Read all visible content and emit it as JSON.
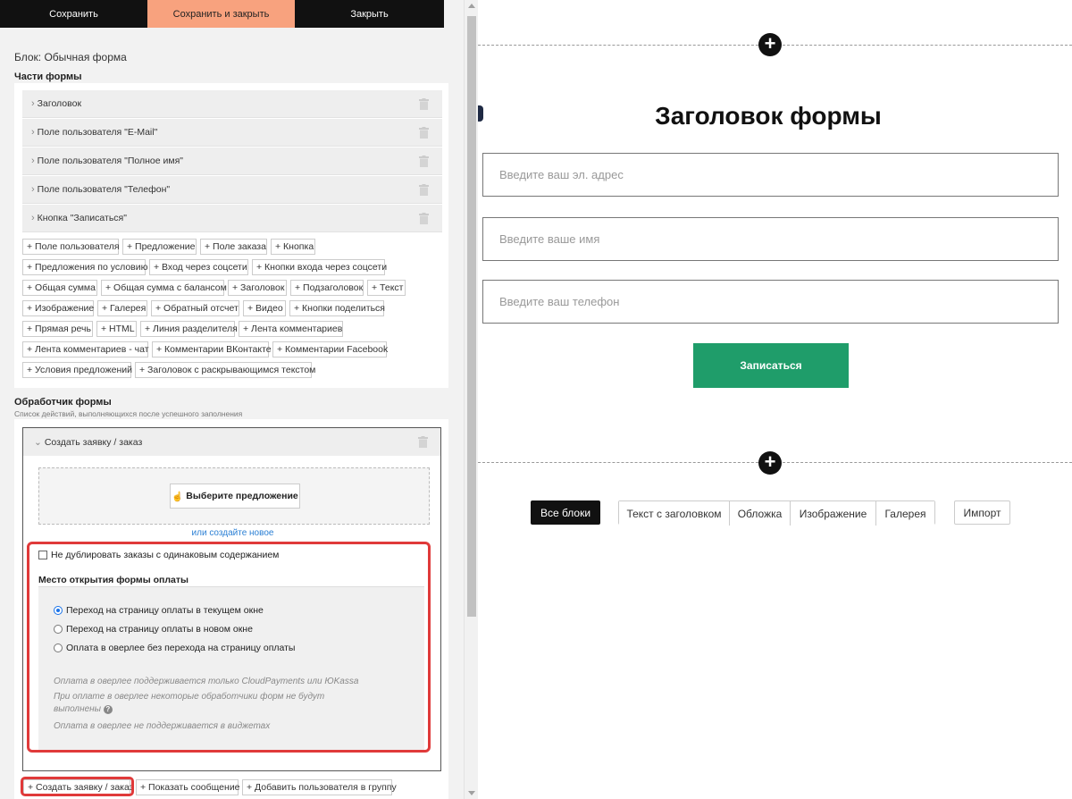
{
  "toolbar": {
    "save": "Сохранить",
    "save_close": "Сохранить и закрыть",
    "close": "Закрыть"
  },
  "block": {
    "title": "Блок: Обычная форма",
    "parts_heading": "Части формы"
  },
  "parts": [
    "Заголовок",
    "Поле пользователя \"E-Mail\"",
    "Поле пользователя \"Полное имя\"",
    "Поле пользователя \"Телефон\"",
    "Кнопка \"Записаться\""
  ],
  "add_buttons": [
    "+ Поле пользователя",
    "+ Предложение",
    "+ Поле заказа",
    "+ Кнопка",
    "+ Предложения по условию",
    "+ Вход через соцсети",
    "+ Кнопки входа через соцсети",
    "+ Общая сумма",
    "+ Общая сумма с балансом",
    "+ Заголовок",
    "+ Подзаголовок",
    "+ Текст",
    "+ Изображение",
    "+ Галерея",
    "+ Обратный отсчет",
    "+ Видео",
    "+ Кнопки поделиться",
    "+ Прямая речь",
    "+ HTML",
    "+ Линия разделителя",
    "+ Лента комментариев",
    "+ Лента комментариев - чат",
    "+ Комментарии ВКонтакте",
    "+ Комментарии Facebook",
    "+ Условия предложений",
    "+ Заголовок с раскрывающимся текстом"
  ],
  "handler": {
    "heading": "Обработчик формы",
    "subheading": "Список действий, выполняющихся после успешного заполнения",
    "action_title": "Создать заявку / заказ",
    "choose_offer": "Выберите предложение",
    "create_new": "или создайте новое",
    "no_duplicate": "Не дублировать заказы с одинаковым содержанием",
    "pay_heading": "Место открытия формы оплаты",
    "pay_options": [
      "Переход на страницу оплаты в текущем окне",
      "Переход на страницу оплаты в новом окне",
      "Оплата в оверлее без перехода на страницу оплаты"
    ],
    "pay_selected": 0,
    "notes": [
      "Оплата в оверлее поддерживается только CloudPayments или ЮKassa",
      "При оплате в оверлее некоторые обработчики форм не будут",
      "выполнены",
      "Оплата в оверлее не поддерживается в виджетах"
    ]
  },
  "bottom_tags": [
    "+ Создать заявку / заказ",
    "+ Показать сообщение",
    "+ Добавить пользователя в группу"
  ],
  "preview": {
    "title": "Заголовок формы",
    "email_placeholder": "Введите ваш эл. адрес",
    "name_placeholder": "Введите ваше имя",
    "phone_placeholder": "Введите ваш телефон",
    "submit": "Записаться",
    "submit_color": "#1f9d6a"
  },
  "filters": {
    "all": "Все блоки",
    "group": [
      "Текст с заголовком",
      "Обложка",
      "Изображение",
      "Галерея"
    ],
    "import": "Импорт"
  },
  "colors": {
    "accent_orange": "#f8a27e",
    "highlight_red": "#e03a3a",
    "link_blue": "#2a7fd4"
  }
}
